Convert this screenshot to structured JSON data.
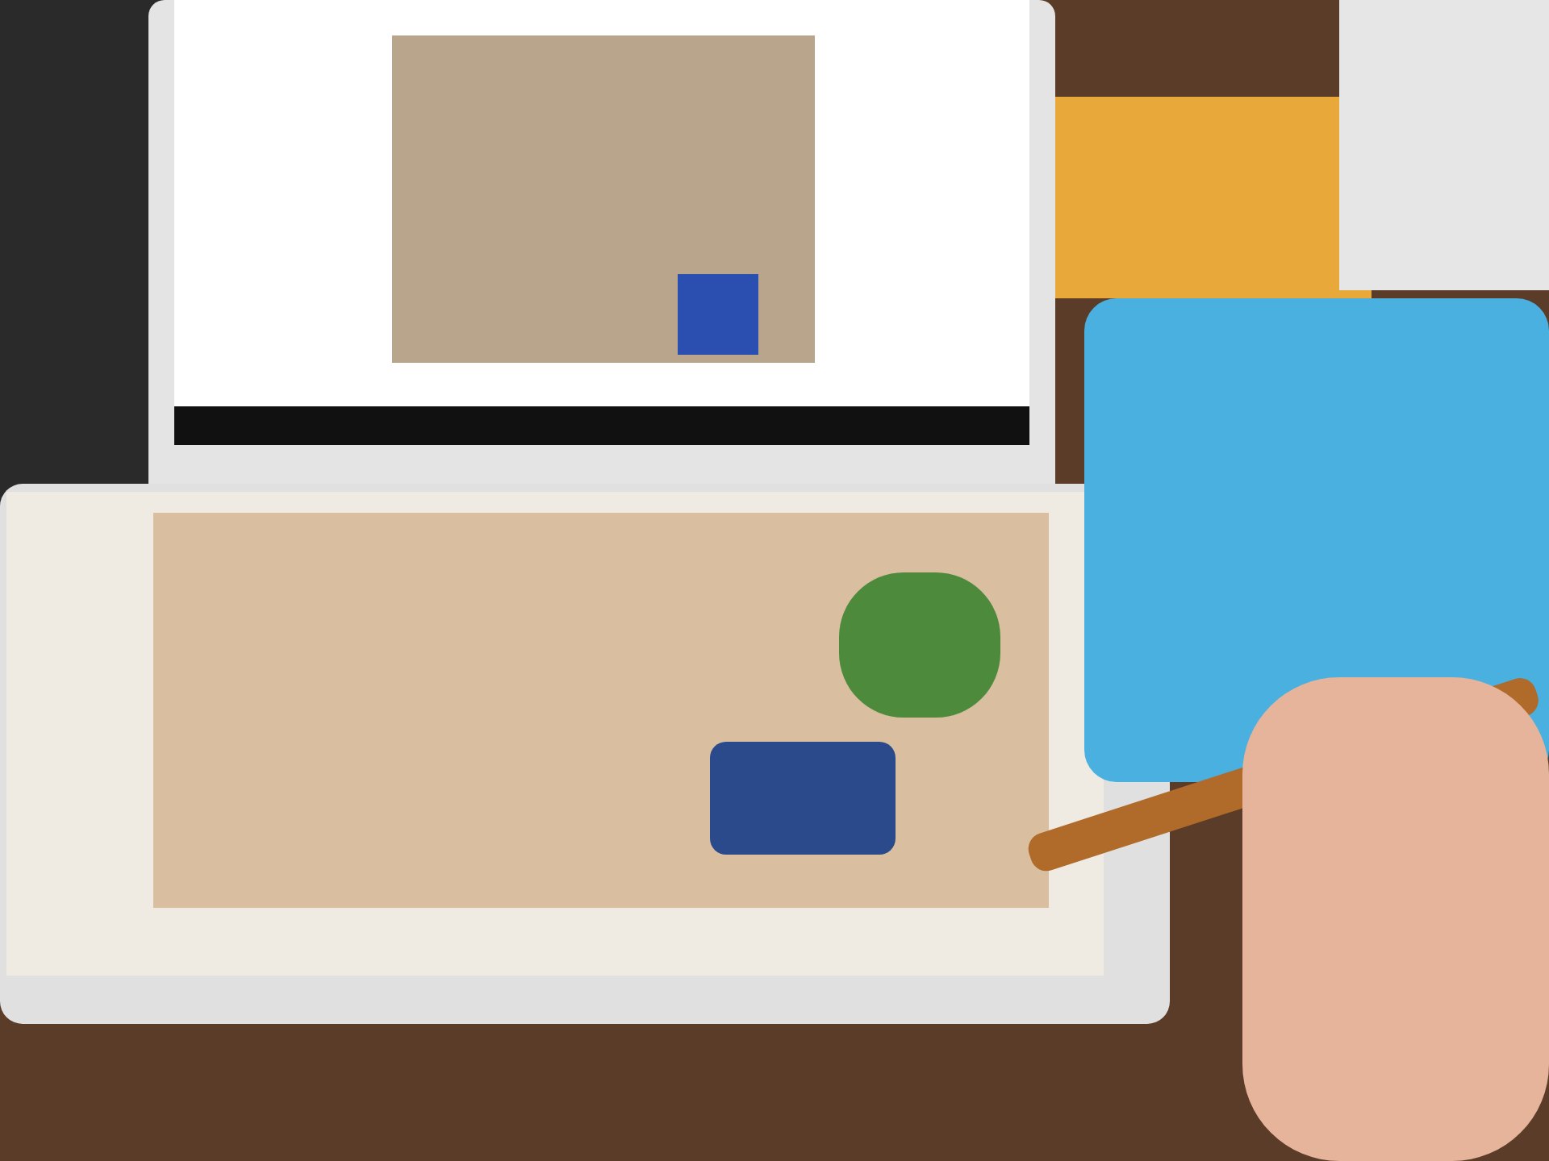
{
  "photo": {
    "kind": "photograph"
  }
}
